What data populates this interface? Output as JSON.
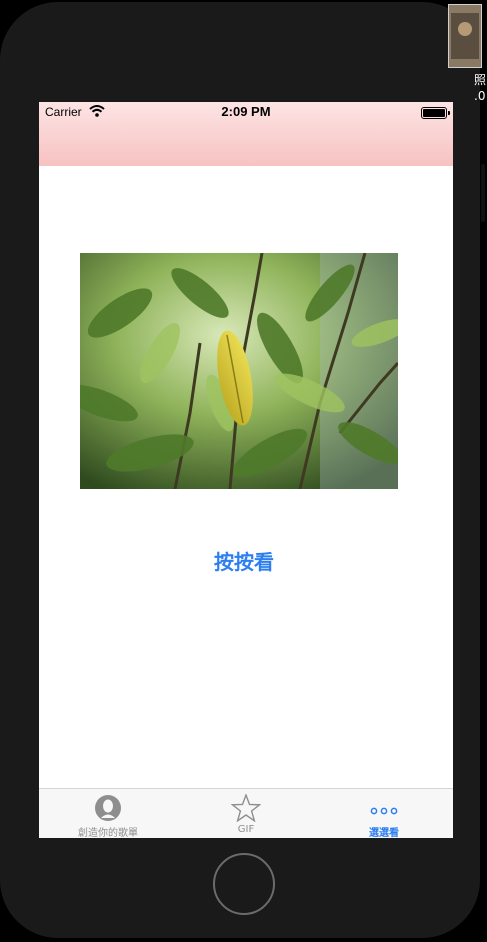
{
  "status_bar": {
    "carrier": "Carrier",
    "time": "2:09 PM"
  },
  "main": {
    "photo_icon": "leaf-photo",
    "tap_button_label": "按按看"
  },
  "tabbar": {
    "items": [
      {
        "label": "創造你的歌單",
        "icon": "person-icon",
        "active": false
      },
      {
        "label": "GIF",
        "icon": "star-icon",
        "active": false
      },
      {
        "label": "選選看",
        "icon": "more-icon",
        "active": true
      }
    ]
  },
  "desktop": {
    "corner_text_1": "照",
    "corner_text_2": ".0"
  },
  "colors": {
    "navbar_top": "#fde4e4",
    "navbar_bottom": "#f7c2c2",
    "accent": "#2d7ff0",
    "tab_inactive": "#8e8e8e"
  }
}
